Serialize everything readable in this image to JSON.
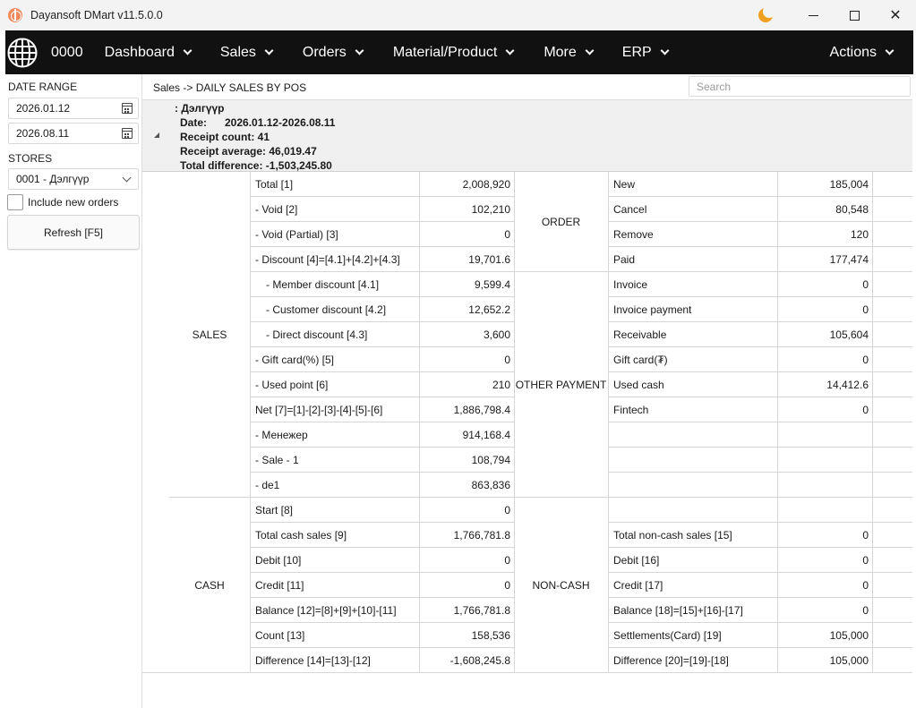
{
  "window": {
    "title": "Dayansoft DMart v11.5.0.0",
    "minimize": "",
    "maximize": "",
    "close": "✕"
  },
  "menu": {
    "store_code": "0000",
    "items": [
      {
        "label": "Dashboard"
      },
      {
        "label": "Sales"
      },
      {
        "label": "Orders"
      },
      {
        "label": "Material/Product"
      },
      {
        "label": "More"
      },
      {
        "label": "ERP"
      }
    ],
    "actions_label": "Actions"
  },
  "filters": {
    "date_range_label": "DATE RANGE",
    "date_from": "2026.01.12",
    "date_to": "2026.08.11",
    "stores_label": "STORES",
    "store_selected": "0001 - Дэлгүүр",
    "include_new_orders_label": "Include new orders",
    "include_new_orders_checked": false,
    "refresh_label": "Refresh [F5]"
  },
  "breadcrumb": "Sales -> DAILY SALES BY POS",
  "search": {
    "placeholder": "Search"
  },
  "group": {
    "store": ": Дэлгүүр",
    "date_label": "Date:",
    "date_value": "2026.01.12-2026.08.11",
    "receipt_count": "Receipt count: 41",
    "receipt_average": "Receipt average: 46,019.47",
    "total_difference": "Total difference: -1,503,245.80"
  },
  "report": {
    "sections": {
      "sales": "SALES",
      "order": "ORDER",
      "other_payment": "OTHER PAYMENT",
      "cash": "CASH",
      "non_cash": "NON-CASH"
    },
    "rows": [
      {
        "left_label": "Total [1]",
        "left_value": "2,008,920",
        "right_label": "New",
        "right_value": "185,004"
      },
      {
        "left_label": "- Void [2]",
        "left_value": "102,210",
        "right_label": "Cancel",
        "right_value": "80,548"
      },
      {
        "left_label": "- Void (Partial) [3]",
        "left_value": "0",
        "right_label": "Remove",
        "right_value": "120"
      },
      {
        "left_label": "- Discount [4]=[4.1]+[4.2]+[4.3]",
        "left_value": "19,701.6",
        "right_label": "Paid",
        "right_value": "177,474"
      },
      {
        "left_label": "- Member discount [4.1]",
        "left_value": "9,599.4",
        "right_label": "Invoice",
        "right_value": "0"
      },
      {
        "left_label": "- Customer discount [4.2]",
        "left_value": "12,652.2",
        "right_label": "Invoice payment",
        "right_value": "0"
      },
      {
        "left_label": "- Direct discount [4.3]",
        "left_value": "3,600",
        "right_label": "Receivable",
        "right_value": "105,604"
      },
      {
        "left_label": "- Gift card(%) [5]",
        "left_value": "0",
        "right_label": "Gift card(₮)",
        "right_value": "0"
      },
      {
        "left_label": "- Used point [6]",
        "left_value": "210",
        "right_label": "Used cash",
        "right_value": "14,412.6"
      },
      {
        "left_label": "Net [7]=[1]-[2]-[3]-[4]-[5]-[6]",
        "left_value": "1,886,798.4",
        "right_label": "Fintech",
        "right_value": "0"
      },
      {
        "left_label": "- Менежер",
        "left_value": "914,168.4",
        "right_label": "",
        "right_value": ""
      },
      {
        "left_label": "- Sale - 1",
        "left_value": "108,794",
        "right_label": "",
        "right_value": ""
      },
      {
        "left_label": "- de1",
        "left_value": "863,836",
        "right_label": "",
        "right_value": ""
      },
      {
        "left_label": "Start [8]",
        "left_value": "0",
        "right_label": "",
        "right_value": ""
      },
      {
        "left_label": "Total cash sales [9]",
        "left_value": "1,766,781.8",
        "right_label": "Total non-cash sales [15]",
        "right_value": "0"
      },
      {
        "left_label": "Debit [10]",
        "left_value": "0",
        "right_label": "Debit [16]",
        "right_value": "0"
      },
      {
        "left_label": "Credit [11]",
        "left_value": "0",
        "right_label": "Credit [17]",
        "right_value": "0"
      },
      {
        "left_label": "Balance [12]=[8]+[9]+[10]-[11]",
        "left_value": "1,766,781.8",
        "right_label": "Balance [18]=[15]+[16]-[17]",
        "right_value": "0"
      },
      {
        "left_label": "Count [13]",
        "left_value": "158,536",
        "right_label": "Settlements(Card) [19]",
        "right_value": "105,000"
      },
      {
        "left_label": "Difference [14]=[13]-[12]",
        "left_value": "-1,608,245.8",
        "right_label": "Difference [20]=[19]-[18]",
        "right_value": "105,000"
      }
    ]
  }
}
